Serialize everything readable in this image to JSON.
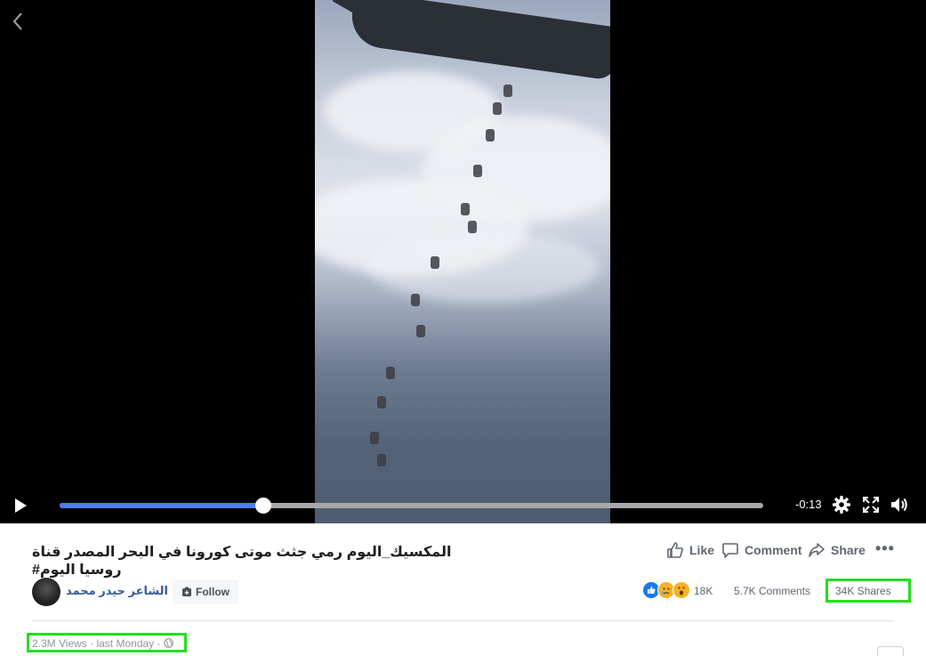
{
  "video": {
    "time_remaining": "-0:13",
    "progress": 0.29
  },
  "post": {
    "title": "المكسيك_اليوم رمي جثث موتى كورونا في البحر المصدر قناة روسيا اليوم#",
    "author": "الشاعر حيدر محمد",
    "follow_label": "Follow",
    "actions": {
      "like": "Like",
      "comment": "Comment",
      "share": "Share",
      "more": "•••"
    },
    "reactions_count": "18K",
    "comments_count": "5.7K Comments",
    "shares_count": "34K Shares",
    "views_text": "2.3M Views · last Monday ·"
  },
  "colors": {
    "accent": "#4a7ff0",
    "link": "#385898",
    "highlight": "#22e01e"
  },
  "icons": [
    "back-icon",
    "play-icon",
    "settings-icon",
    "fullscreen-icon",
    "volume-icon",
    "like-icon",
    "comment-icon",
    "share-icon",
    "follow-icon",
    "globe-icon"
  ]
}
